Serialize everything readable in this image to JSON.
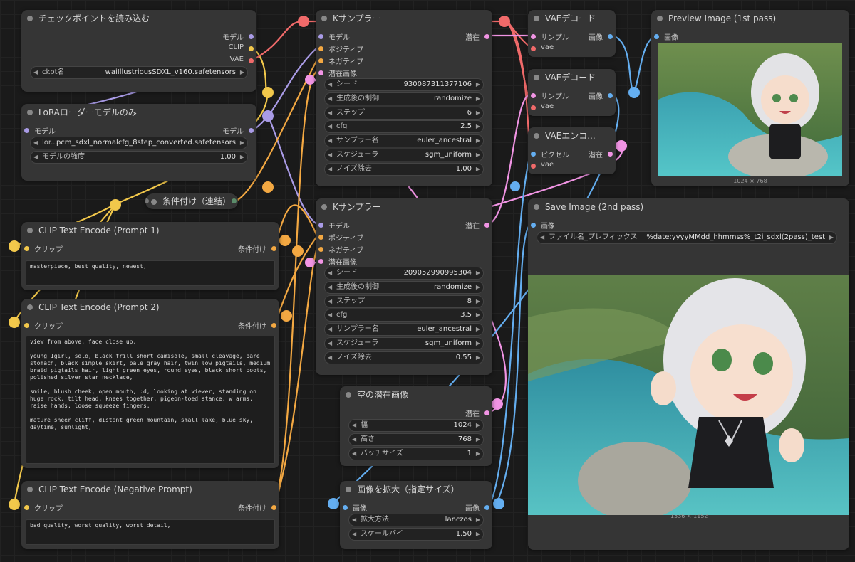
{
  "colors": {
    "clip": "#f2c84b",
    "model": "#a99be6",
    "vae": "#f06a6a",
    "conditioning": "#f3a842",
    "latent": "#f194e4",
    "image": "#64aef0"
  },
  "checkpoint": {
    "title": "チェックポイントを読み込む",
    "out_model": "モデル",
    "out_clip": "CLIP",
    "out_vae": "VAE",
    "ckpt_label": "ckpt名",
    "ckpt_value": "waiIllustriousSDXL_v160.safetensors"
  },
  "lora": {
    "title": "LoRAローダーモデルのみ",
    "in_model": "モデル",
    "out_model": "モデル",
    "lora_label": "lor...",
    "lora_value": "pcm_sdxl_normalcfg_8step_converted.safetensors",
    "strength_label": "モデルの強度",
    "strength_value": "1.00"
  },
  "concat": {
    "title": "条件付け（連結）"
  },
  "prompt1": {
    "title": "CLIP Text Encode (Prompt 1)",
    "in_clip": "クリップ",
    "out_cond": "条件付け",
    "text": "masterpiece, best quality, newest,"
  },
  "prompt2": {
    "title": "CLIP Text Encode (Prompt 2)",
    "in_clip": "クリップ",
    "out_cond": "条件付け",
    "text": "view from above, face close up,\n\nyoung 1girl, solo, black frill short camisole, small cleavage, bare stomach, black simple skirt, pale gray hair, twin low pigtails, medium braid pigtails hair, light green eyes, round eyes, black short boots, polished silver star necklace,\n\nsmile, blush cheek, open mouth, :d, looking at viewer, standing on huge rock, tilt head, knees together, pigeon-toed stance, w arms, raise hands, loose squeeze fingers,\n\nmature sheer cliff, distant green mountain, small lake, blue sky, daytime, sunlight,"
  },
  "negative": {
    "title": "CLIP Text Encode (Negative Prompt)",
    "in_clip": "クリップ",
    "out_cond": "条件付け",
    "text": "bad quality, worst quality, worst detail,"
  },
  "ksampler1": {
    "title": "Kサンプラー",
    "in_model": "モデル",
    "in_pos": "ポジティブ",
    "in_neg": "ネガティブ",
    "in_latent": "潜在画像",
    "out_latent": "潜在",
    "widgets": [
      {
        "label": "シード",
        "value": "930087311377106"
      },
      {
        "label": "生成後の制御",
        "value": "randomize"
      },
      {
        "label": "ステップ",
        "value": "6"
      },
      {
        "label": "cfg",
        "value": "2.5"
      },
      {
        "label": "サンプラー名",
        "value": "euler_ancestral"
      },
      {
        "label": "スケジューラ",
        "value": "sgm_uniform"
      },
      {
        "label": "ノイズ除去",
        "value": "1.00"
      }
    ]
  },
  "ksampler2": {
    "title": "Kサンプラー",
    "in_model": "モデル",
    "in_pos": "ポジティブ",
    "in_neg": "ネガティブ",
    "in_latent": "潜在画像",
    "out_latent": "潜在",
    "widgets": [
      {
        "label": "シード",
        "value": "209052990995304"
      },
      {
        "label": "生成後の制御",
        "value": "randomize"
      },
      {
        "label": "ステップ",
        "value": "8"
      },
      {
        "label": "cfg",
        "value": "3.5"
      },
      {
        "label": "サンプラー名",
        "value": "euler_ancestral"
      },
      {
        "label": "スケジューラ",
        "value": "sgm_uniform"
      },
      {
        "label": "ノイズ除去",
        "value": "0.55"
      }
    ]
  },
  "empty_latent": {
    "title": "空の潜在画像",
    "out_latent": "潜在",
    "width_label": "幅",
    "width_value": "1024",
    "height_label": "高さ",
    "height_value": "768",
    "batch_label": "バッチサイズ",
    "batch_value": "1"
  },
  "upscale": {
    "title": "画像を拡大（指定サイズ）",
    "in_image": "画像",
    "out_image": "画像",
    "method_label": "拡大方法",
    "method_value": "lanczos",
    "scale_label": "スケールバイ",
    "scale_value": "1.50"
  },
  "vaedecode1": {
    "title": "VAEデコード",
    "in_samples": "サンプル",
    "in_vae": "vae",
    "out_image": "画像"
  },
  "vaedecode2": {
    "title": "VAEデコード",
    "in_samples": "サンプル",
    "in_vae": "vae",
    "out_image": "画像"
  },
  "vaeencode": {
    "title": "VAEエンコ...",
    "in_pixels": "ピクセル",
    "in_vae": "vae",
    "out_latent": "潜在"
  },
  "preview": {
    "title": "Preview Image (1st pass)",
    "in_image": "画像",
    "size": "1024 × 768"
  },
  "save": {
    "title": "Save Image (2nd pass)",
    "in_image": "画像",
    "prefix_label": "ファイル名_プレフィックス",
    "prefix_value": "%date:yyyyMMdd_hhmmss%_t2i_sdxl(2pass)_test",
    "size": "1536 × 1152"
  }
}
